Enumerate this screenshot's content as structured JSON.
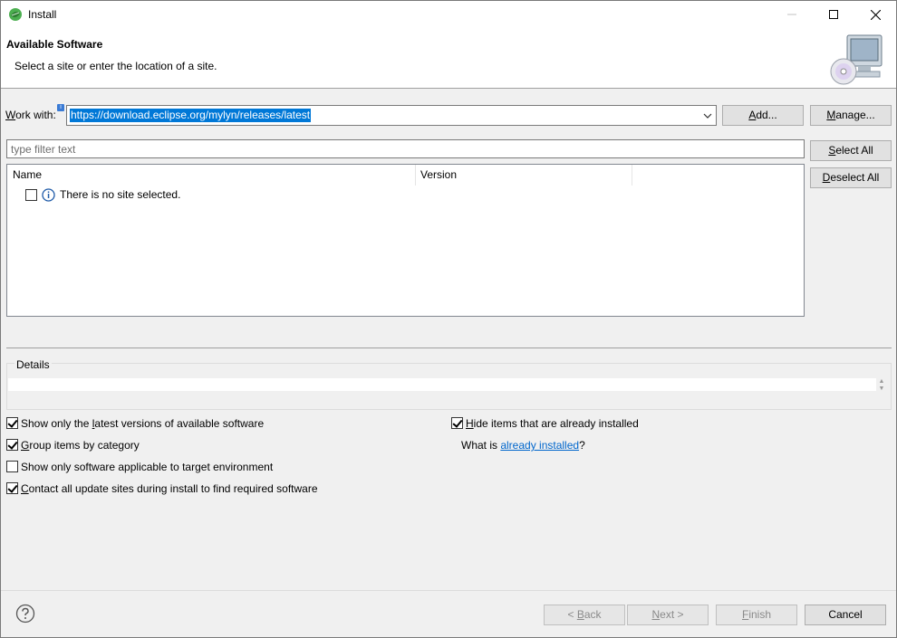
{
  "window": {
    "title": "Install",
    "icons": {
      "app": "eclipse-leaf-icon",
      "minimize": "minimize-icon",
      "maximize": "maximize-icon",
      "close": "close-icon"
    }
  },
  "banner": {
    "title": "Available Software",
    "subtitle": "Select a site or enter the location of a site.",
    "image": "install-wizard-cd-computer-icon"
  },
  "work_with": {
    "label_mnemonic": "W",
    "label_rest": "ork with:",
    "value": "https://download.eclipse.org/mylyn/releases/latest",
    "add_mnemonic": "A",
    "add_rest": "dd...",
    "manage_mnemonic": "M",
    "manage_rest": "anage..."
  },
  "filter": {
    "placeholder": "type filter text"
  },
  "selection_buttons": {
    "select_all_mnemonic": "S",
    "select_all_rest": "elect All",
    "deselect_all_mnemonic": "D",
    "deselect_all_rest": "eselect All"
  },
  "tree": {
    "columns": [
      "Name",
      "Version"
    ],
    "rows": [
      {
        "text": "There is no site selected.",
        "checked": false,
        "icon": "info-icon"
      }
    ]
  },
  "details": {
    "label": "Details",
    "text": ""
  },
  "options": {
    "latest_pre": "Show only the ",
    "latest_mnemonic": "l",
    "latest_post": "atest versions of available software",
    "latest_checked": true,
    "group_pre": "",
    "group_mnemonic": "G",
    "group_post": "roup items by category",
    "group_checked": true,
    "target_label": "Show only software applicable to target environment",
    "target_checked": false,
    "contact_pre": "",
    "contact_mnemonic": "C",
    "contact_post": "ontact all update sites during install to find required software",
    "contact_checked": true,
    "hide_pre": "",
    "hide_mnemonic": "H",
    "hide_post": "ide items that are already installed",
    "hide_checked": true,
    "what_is_pre": "What is ",
    "what_is_link": "already installed",
    "what_is_post": "?"
  },
  "footer": {
    "help_icon": "help-question-icon",
    "back_pre": "< ",
    "back_mnemonic": "B",
    "back_rest": "ack",
    "next_mnemonic": "N",
    "next_rest": "ext >",
    "finish_mnemonic": "F",
    "finish_rest": "inish",
    "cancel": "Cancel",
    "back_enabled": false,
    "next_enabled": false,
    "finish_enabled": false
  }
}
